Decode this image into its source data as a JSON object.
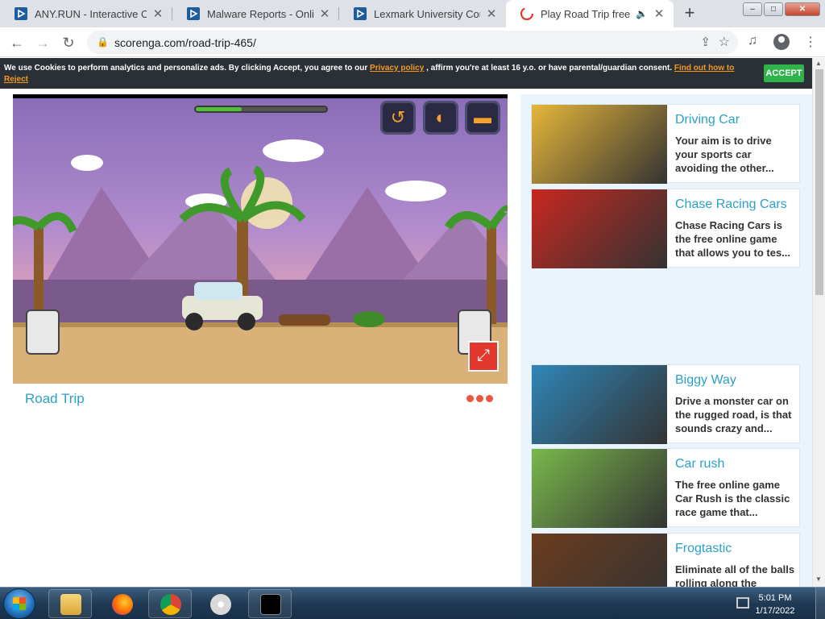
{
  "browser": {
    "tabs": [
      {
        "title": "ANY.RUN - Interactive Onli",
        "icon": "anyrun-icon",
        "active": false
      },
      {
        "title": "Malware Reports - Online I",
        "icon": "anyrun-icon",
        "active": false
      },
      {
        "title": "Lexmark University Course",
        "icon": "anyrun-icon",
        "active": false
      },
      {
        "title": "Play Road Trip free onli",
        "icon": "scorenga-icon",
        "active": true,
        "audio": "🔈"
      }
    ],
    "new_tab": "+",
    "url": "scorenga.com/road-trip-465/",
    "window_buttons": [
      "–",
      "□",
      "✕"
    ]
  },
  "cookie_banner": {
    "text_before": "We use Cookies to perform analytics and personalize ads. By clicking Accept, you agree to our ",
    "privacy_link": "Privacy policy",
    "text_middle": " , affirm you're at least 16 y.o. or have parental/guardian consent. ",
    "reject_link": "Find out how to Reject",
    "accept_label": "ACCEPT"
  },
  "game": {
    "title": "Road Trip",
    "hud_buttons": [
      "restart-icon",
      "headlight-icon",
      "car-icon"
    ],
    "fuel_level": 0.35,
    "expand_glyph": "⤢"
  },
  "sidebar": {
    "cards": [
      {
        "title": "Driving Car",
        "desc": "Your aim is to drive your sports car avoiding the other...",
        "thumb_color": "#e6b63a"
      },
      {
        "title": "Chase Racing Cars",
        "desc": "Chase Racing Cars is the free online game that allows you to tes...",
        "thumb_color": "#c7281f"
      },
      {
        "title": "Biggy Way",
        "desc": "Drive a monster car on the rugged road, is that sounds crazy and...",
        "thumb_color": "#2f86b8"
      },
      {
        "title": "Car rush",
        "desc": "The free online game Car Rush is the classic race game that...",
        "thumb_color": "#79b84a"
      },
      {
        "title": "Frogtastic",
        "desc": "Eliminate all of the balls rolling along the",
        "thumb_color": "#6a3c1e"
      }
    ]
  },
  "taskbar": {
    "apps": [
      "explorer-icon",
      "firefox-icon",
      "chrome-icon",
      "paint-icon",
      "cmd-icon"
    ],
    "time": "5:01 PM",
    "date": "1/17/2022"
  }
}
